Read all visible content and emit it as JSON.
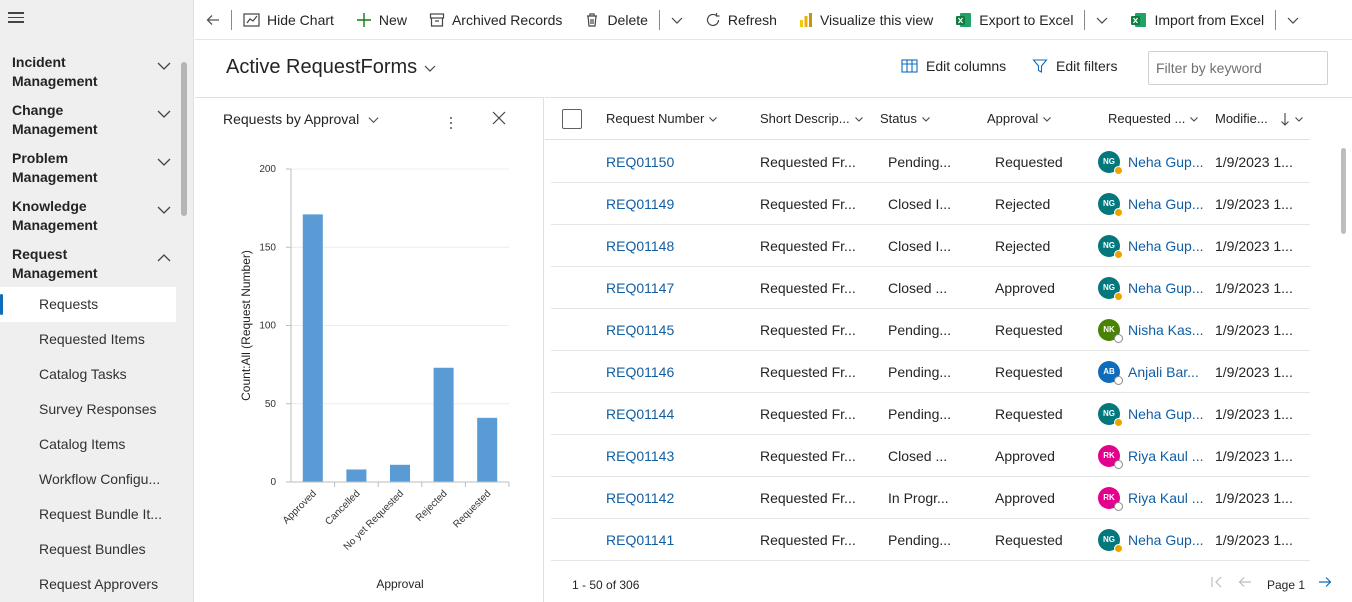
{
  "sidebar": {
    "sections": [
      {
        "line1": "Incident",
        "line2": "Management",
        "expanded": false
      },
      {
        "line1": "Change",
        "line2": "Management",
        "expanded": false
      },
      {
        "line1": "Problem",
        "line2": "Management",
        "expanded": false
      },
      {
        "line1": "Knowledge",
        "line2": "Management",
        "expanded": false
      },
      {
        "line1": "Request",
        "line2": "Management",
        "expanded": true
      }
    ],
    "items": [
      {
        "label": "Requests",
        "active": true
      },
      {
        "label": "Requested Items"
      },
      {
        "label": "Catalog Tasks"
      },
      {
        "label": "Survey Responses"
      },
      {
        "label": "Catalog Items"
      },
      {
        "label": "Workflow Configu..."
      },
      {
        "label": "Request Bundle It..."
      },
      {
        "label": "Request Bundles"
      },
      {
        "label": "Request Approvers"
      }
    ]
  },
  "toolbar": {
    "hide_chart": "Hide Chart",
    "new": "New",
    "archived": "Archived Records",
    "delete": "Delete",
    "refresh": "Refresh",
    "visualize": "Visualize this view",
    "export": "Export to Excel",
    "import": "Import from Excel"
  },
  "header": {
    "title": "Active RequestForms",
    "edit_columns": "Edit columns",
    "edit_filters": "Edit filters",
    "filter_placeholder": "Filter by keyword"
  },
  "chart_panel": {
    "title": "Requests by Approval"
  },
  "chart_data": {
    "type": "bar",
    "categories": [
      "Approved",
      "Cancelled",
      "No yet Requested",
      "Rejected",
      "Requested"
    ],
    "values": [
      171,
      8,
      11,
      73,
      41
    ],
    "ylim": [
      0,
      200
    ],
    "yticks": [
      0,
      50,
      100,
      150,
      200
    ],
    "xlabel": "Approval",
    "ylabel": "Count:All (Request Number)",
    "grid": true,
    "color": "#5b9bd5"
  },
  "grid": {
    "columns": [
      "Request Number",
      "Short Descrip...",
      "Status",
      "Approval",
      "Requested ...",
      "Modifie..."
    ],
    "rows": [
      {
        "number": "REQ01150",
        "short": "Requested Fr...",
        "status": "Pending...",
        "approval": "Requested",
        "initials": "NG",
        "user": "Neha Gup...",
        "modified": "1/9/2023 1...",
        "avatar_color": "#03787c",
        "presence": "away"
      },
      {
        "number": "REQ01149",
        "short": "Requested Fr...",
        "status": "Closed I...",
        "approval": "Rejected",
        "initials": "NG",
        "user": "Neha Gup...",
        "modified": "1/9/2023 1...",
        "avatar_color": "#03787c",
        "presence": "away"
      },
      {
        "number": "REQ01148",
        "short": "Requested Fr...",
        "status": "Closed I...",
        "approval": "Rejected",
        "initials": "NG",
        "user": "Neha Gup...",
        "modified": "1/9/2023 1...",
        "avatar_color": "#03787c",
        "presence": "away"
      },
      {
        "number": "REQ01147",
        "short": "Requested Fr...",
        "status": "Closed ...",
        "approval": "Approved",
        "initials": "NG",
        "user": "Neha Gup...",
        "modified": "1/9/2023 1...",
        "avatar_color": "#03787c",
        "presence": "away"
      },
      {
        "number": "REQ01145",
        "short": "Requested Fr...",
        "status": "Pending...",
        "approval": "Requested",
        "initials": "NK",
        "user": "Nisha Kas...",
        "modified": "1/9/2023 1...",
        "avatar_color": "#498205",
        "presence": "offline"
      },
      {
        "number": "REQ01146",
        "short": "Requested Fr...",
        "status": "Pending...",
        "approval": "Requested",
        "initials": "AB",
        "user": "Anjali Bar...",
        "modified": "1/9/2023 1...",
        "avatar_color": "#0f6cbd",
        "presence": "offline"
      },
      {
        "number": "REQ01144",
        "short": "Requested Fr...",
        "status": "Pending...",
        "approval": "Requested",
        "initials": "NG",
        "user": "Neha Gup...",
        "modified": "1/9/2023 1...",
        "avatar_color": "#03787c",
        "presence": "away"
      },
      {
        "number": "REQ01143",
        "short": "Requested Fr...",
        "status": "Closed ...",
        "approval": "Approved",
        "initials": "RK",
        "user": "Riya Kaul ...",
        "modified": "1/9/2023 1...",
        "avatar_color": "#e3008c",
        "presence": "offline"
      },
      {
        "number": "REQ01142",
        "short": "Requested Fr...",
        "status": "In Progr...",
        "approval": "Approved",
        "initials": "RK",
        "user": "Riya Kaul ...",
        "modified": "1/9/2023 1...",
        "avatar_color": "#e3008c",
        "presence": "offline"
      },
      {
        "number": "REQ01141",
        "short": "Requested Fr...",
        "status": "Pending...",
        "approval": "Requested",
        "initials": "NG",
        "user": "Neha Gup...",
        "modified": "1/9/2023 1...",
        "avatar_color": "#03787c",
        "presence": "away"
      }
    ]
  },
  "footer": {
    "count": "1 - 50 of 306",
    "page": "Page 1"
  }
}
